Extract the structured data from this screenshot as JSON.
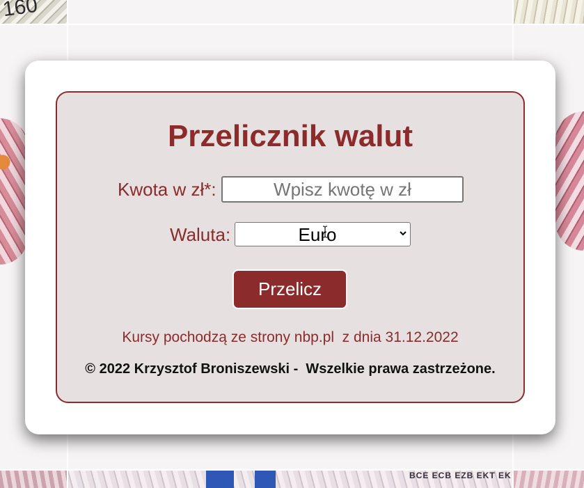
{
  "background": {
    "top_left_banknote_text": "160"
  },
  "converter": {
    "title": "Przelicznik walut",
    "amount_label": "Kwota w zł*:",
    "amount_placeholder": "Wpisz kwotę w zł",
    "amount_value": "",
    "currency_label": "Waluta:",
    "currency_selected": "Euro",
    "convert_button_label": "Przelicz",
    "rates_note": "Kursy pochodzą ze strony nbp.pl  z dnia 31.12.2022",
    "copyright": "© 2022 Krzysztof Broniszewski -  Wszelkie prawa zastrzeżone."
  },
  "colors": {
    "accent": "#8b2b2b",
    "panel_background": "#e6e0e1",
    "card_background": "#ffffff"
  },
  "icons": {
    "select_chevron": "chevron-down-icon",
    "mouse_cursor": "text-cursor-icon"
  }
}
